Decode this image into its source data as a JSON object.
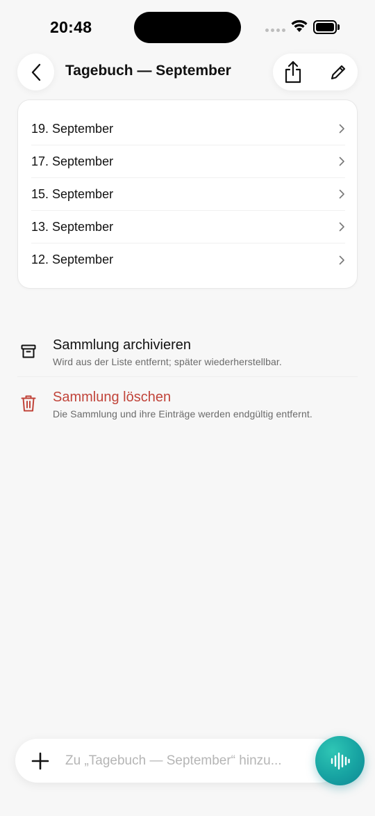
{
  "status_bar": {
    "time": "20:48"
  },
  "header": {
    "title": "Tagebuch — September",
    "back_icon": "chevron-left-icon",
    "share_icon": "share-icon",
    "edit_icon": "pencil-icon"
  },
  "entries": [
    {
      "label": "19. September"
    },
    {
      "label": "17. September"
    },
    {
      "label": "15. September"
    },
    {
      "label": "13. September"
    },
    {
      "label": "12. September"
    }
  ],
  "actions": {
    "archive": {
      "title": "Sammlung archivieren",
      "description": "Wird aus der Liste entfernt; später wiederherstellbar.",
      "icon": "archive-box-icon"
    },
    "delete": {
      "title": "Sammlung löschen",
      "description": "Die Sammlung und ihre Einträge werden endgültig entfernt.",
      "icon": "trash-icon",
      "color": "#c1443a"
    }
  },
  "composer": {
    "placeholder": "Zu „Tagebuch — September“ hinzu...",
    "value": "",
    "plus_icon": "plus-icon",
    "voice_icon": "waveform-icon",
    "voice_button_color": "#17a3a2"
  }
}
